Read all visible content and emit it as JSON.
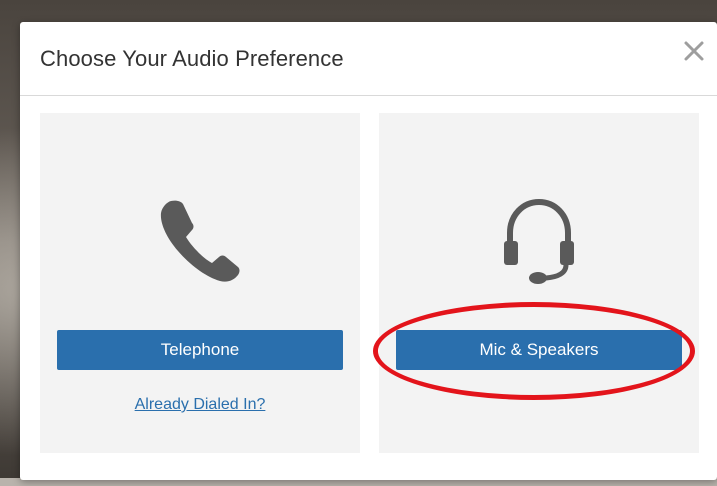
{
  "dialog": {
    "title": "Choose Your Audio Preference",
    "close_symbol": "✕"
  },
  "options": {
    "telephone": {
      "icon": "phone-icon",
      "button_label": "Telephone",
      "link_label": "Already Dialed In?"
    },
    "computer_audio": {
      "icon": "headset-icon",
      "button_label": "Mic & Speakers"
    }
  },
  "colors": {
    "button_bg": "#2a6fad",
    "panel_bg": "#f3f3f3",
    "icon": "#5a5a5a",
    "annotation": "#e3141b"
  }
}
